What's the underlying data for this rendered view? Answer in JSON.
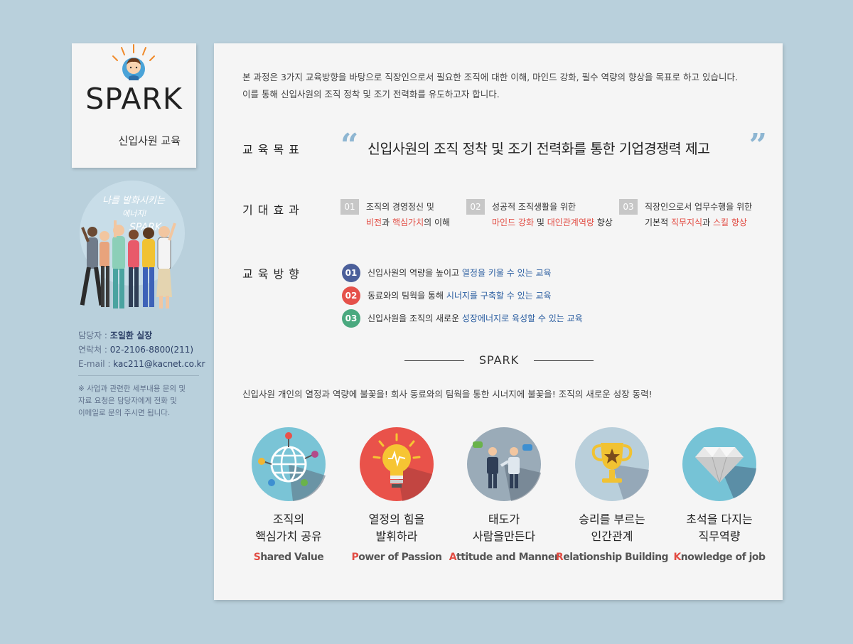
{
  "sidebar": {
    "logo_text": "SPARK",
    "logo_subtitle": "신입사원 교육",
    "illustration_text": [
      "나를 발화시키는",
      "에너지!",
      "SPARK"
    ],
    "contact": {
      "manager_label": "담당자 : ",
      "manager_value": "조일환 실장",
      "phone_label": "연락처 : ",
      "phone_value": "02-2106-8800(211)",
      "email_label": "E-mail : ",
      "email_value": "kac211@kacnet.co.kr"
    },
    "note_lines": [
      "※ 사업과 관련한 세부내용 문의 및",
      "자료 요청은 담당자에게 전화 및",
      "이메일로 문의 주시면 됩니다."
    ]
  },
  "main": {
    "intro_lines": [
      "본 과정은 3가지 교육방향을 바탕으로 직장인으로서 필요한 조직에 대한 이해, 마인드 강화, 필수 역량의 향상을 목표로 하고 있습니다.",
      "이를 통해 신입사원의 조직 정착 및 조기 전력화를 유도하고자 합니다."
    ],
    "goal": {
      "label": "교육목표",
      "open_quote": "“",
      "close_quote": "”",
      "text": "신입사원의 조직 정착 및 조기 전력화를 통한 기업경쟁력 제고"
    },
    "effects": {
      "label": "기대효과",
      "items": [
        {
          "num": "01",
          "line1": "조직의 경영정신 및",
          "hl1": "비전",
          "mid": "과 ",
          "hl2": "핵심가치",
          "tail": "의 이해"
        },
        {
          "num": "02",
          "line1": "성공적 조직생활을 위한",
          "hl1": "마인드 강화",
          "mid": " 및 ",
          "hl2": "대인관계역량",
          "tail": " 향상"
        },
        {
          "num": "03",
          "line1": "직장인으로서 업무수행을 위한",
          "pre": "기본적 ",
          "hl1": "직무지식",
          "mid": "과 ",
          "hl2": "스킬 향상",
          "tail": ""
        }
      ]
    },
    "directions": {
      "label": "교육방향",
      "items": [
        {
          "num": "01",
          "text": "신입사원의 역량을 높이고 ",
          "hl": "열정을 키울 수 있는 교육",
          "color": "#4b5f9a"
        },
        {
          "num": "02",
          "text": "동료와의 팀웍을 통해 ",
          "hl": "시너지를 구축할 수 있는 교육",
          "color": "#e5514a"
        },
        {
          "num": "03",
          "text": "신입사원을 조직의 새로운 ",
          "hl": "성장에너지로 육성할 수 있는 교육",
          "color": "#4aa97f"
        }
      ]
    },
    "spark_heading": "SPARK",
    "tagline": "신입사원 개인의 열정과 역량에 불꽃을! 회사 동료와의 팀웍을 통한 시너지에 불꽃을! 조직의 새로운 성장 동력!",
    "values": [
      {
        "icon": "globe-network-icon",
        "bg": "#7ac4d6",
        "kr": "조직의\n핵심가치 공유",
        "initial": "S",
        "rest": "hared Value"
      },
      {
        "icon": "lightbulb-icon",
        "bg": "#e9524a",
        "kr": "열정의 힘을\n발휘하라",
        "initial": "P",
        "rest": "ower of Passion"
      },
      {
        "icon": "business-people-icon",
        "bg": "#9aabb8",
        "kr": "태도가\n사람을만든다",
        "initial": "A",
        "rest": "ttitude and Manner"
      },
      {
        "icon": "trophy-icon",
        "bg": "#b9cfdb",
        "kr": "승리를 부르는\n인간관계",
        "initial": "R",
        "rest": "elationship Building"
      },
      {
        "icon": "diamond-icon",
        "bg": "#76c3d6",
        "kr": "초석을 다지는\n직무역량",
        "initial": "K",
        "rest": "nowledge of job"
      }
    ]
  },
  "colors": {
    "page_bg": "#b9d0dc",
    "card_bg": "#f5f5f5",
    "accent_red": "#e24c43",
    "accent_blue": "#2a5da0"
  }
}
